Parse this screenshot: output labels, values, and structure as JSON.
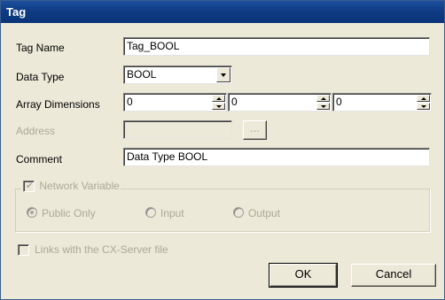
{
  "window": {
    "title": "Tag"
  },
  "fields": {
    "tag_name": {
      "label": "Tag Name",
      "value": "Tag_BOOL"
    },
    "data_type": {
      "label": "Data Type",
      "value": "BOOL"
    },
    "array_dimensions": {
      "label": "Array Dimensions",
      "values": [
        "0",
        "0",
        "0"
      ]
    },
    "address": {
      "label": "Address",
      "value": "",
      "browse_label": "..."
    },
    "comment": {
      "label": "Comment",
      "value": "Data Type BOOL"
    }
  },
  "network_variable": {
    "label": "Network Variable",
    "checked": true,
    "options": [
      {
        "label": "Public Only",
        "selected": true
      },
      {
        "label": "Input",
        "selected": false
      },
      {
        "label": "Output",
        "selected": false
      }
    ]
  },
  "links": {
    "label": "Links with the CX-Server file",
    "checked": false
  },
  "buttons": {
    "ok": "OK",
    "cancel": "Cancel"
  },
  "icons": {
    "dropdown": "chevron-down-icon",
    "spin_up": "spin-up-icon",
    "spin_down": "spin-down-icon",
    "check": "checkmark-icon",
    "radio_dot": "radio-dot-icon"
  },
  "colors": {
    "title_bar": "#0f3c84",
    "dialog_bg": "#ece9d8",
    "disabled_text": "#aca899"
  }
}
